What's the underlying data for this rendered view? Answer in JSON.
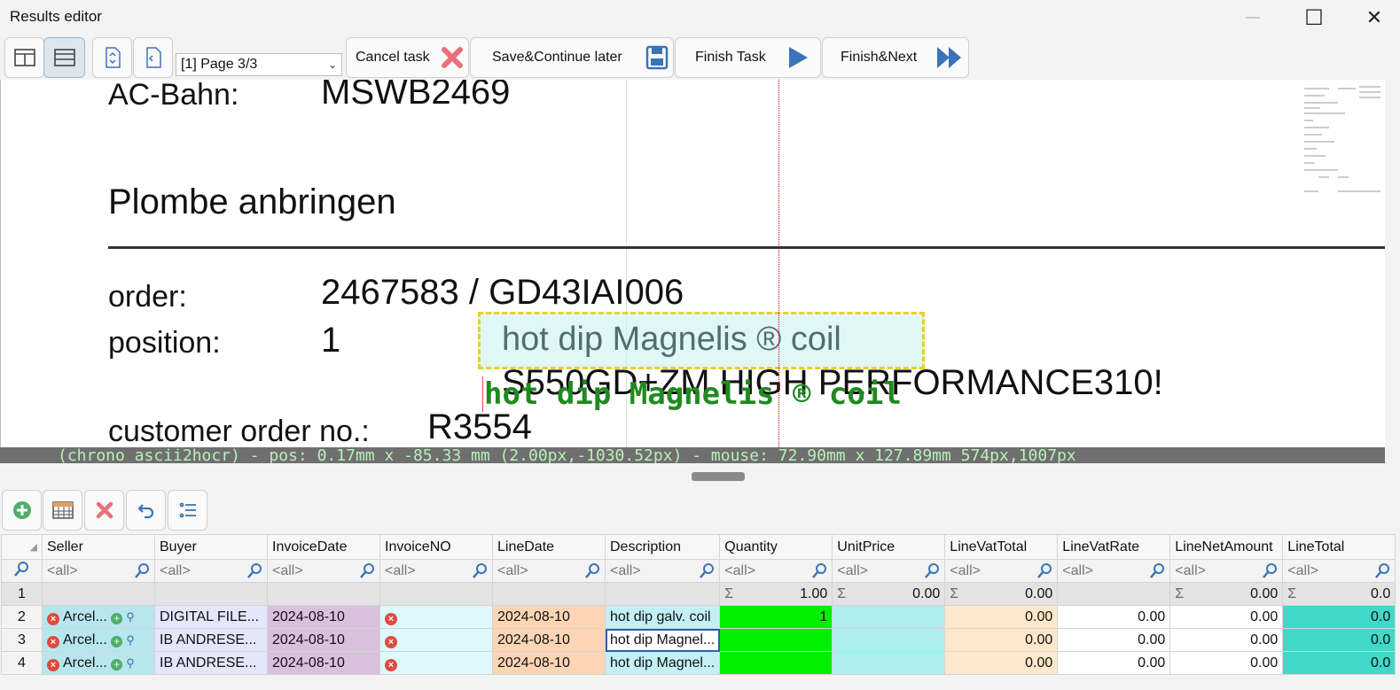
{
  "window": {
    "title": "Results editor",
    "minimize_glyph": "—",
    "maximize_glyph": "☐",
    "close_glyph": "✕"
  },
  "toolbar": {
    "page_select_value": "[1] Page 3/3",
    "cancel_label": "Cancel task",
    "save_label": "Save&Continue later",
    "finish_label": "Finish Task",
    "finish_next_label": "Finish&Next"
  },
  "document": {
    "line1_label": "AC-Bahn:",
    "line1_value": "MSWB2469",
    "heading": "Plombe anbringen",
    "order_label": "order:",
    "order_value": "2467583 / GD43IAI006",
    "position_label": "position:",
    "position_value": "1",
    "product_line": "S550GD+ZM HIGH PERFORMANCE310!",
    "customer_order_label": "customer order no.:",
    "customer_order_value": "R3554",
    "selection_text": "hot dip Magnelis ® coil",
    "ocr_overlay_text": "hot dip Magnelis ® coil"
  },
  "status": {
    "text": "(chrono ascii2hocr) - pos: 0.17mm x -85.33 mm (2.00px,-1030.52px) - mouse: 72.90mm x 127.89mm 574px,1007px"
  },
  "grid": {
    "filter_placeholder": "<all>",
    "columns": [
      "Seller",
      "Buyer",
      "InvoiceDate",
      "InvoiceNO",
      "LineDate",
      "Description",
      "Quantity",
      "UnitPrice",
      "LineVatTotal",
      "LineVatRate",
      "LineNetAmount",
      "LineTotal"
    ],
    "sum_row": {
      "row_no": "1",
      "sigma": "Σ",
      "quantity": "1.00",
      "unit_price": "0.00",
      "line_vat_total": "0.00",
      "line_net_amount": "0.00",
      "line_total": "0.0"
    },
    "rows": [
      {
        "row_no": "2",
        "seller": "Arcel...",
        "buyer": "DIGITAL FILE...",
        "invoice_date": "2024-08-10",
        "invoice_no": "",
        "line_date": "2024-08-10",
        "description": "hot dip galv. coil",
        "quantity": "1",
        "unit_price": "",
        "line_vat_total": "0.00",
        "line_vat_rate": "0.00",
        "line_net_amount": "0.00",
        "line_total": "0.0"
      },
      {
        "row_no": "3",
        "seller": "Arcel...",
        "buyer": "IB ANDRESE...",
        "invoice_date": "2024-08-10",
        "invoice_no": "",
        "line_date": "2024-08-10",
        "description": "hot dip Magnel...",
        "quantity": "",
        "unit_price": "",
        "line_vat_total": "0.00",
        "line_vat_rate": "0.00",
        "line_net_amount": "0.00",
        "line_total": "0.0"
      },
      {
        "row_no": "4",
        "seller": "Arcel...",
        "buyer": "IB ANDRESE...",
        "invoice_date": "2024-08-10",
        "invoice_no": "",
        "line_date": "2024-08-10",
        "description": "hot dip Magnel...",
        "quantity": "",
        "unit_price": "",
        "line_vat_total": "0.00",
        "line_vat_rate": "0.00",
        "line_net_amount": "0.00",
        "line_total": "0.0"
      }
    ]
  },
  "colors": {
    "accent_blue": "#3a74b6",
    "cancel_red": "#e8707a",
    "ocr_green": "#1f8a1f",
    "selection_yellow": "#e8cf2a",
    "quantity_green": "#00ee00",
    "line_total_teal": "#40d8c8"
  },
  "icons": {
    "layout_split_vertical": "layout-split-vertical-icon",
    "layout_split_horizontal": "layout-split-horizontal-icon",
    "fit_page": "fit-page-icon",
    "page_view": "page-view-icon",
    "cancel": "red-x-icon",
    "save": "floppy-disk-icon",
    "finish": "play-icon",
    "finish_next": "fast-forward-icon",
    "add_row": "add-circle-icon",
    "table_view": "table-icon",
    "delete_row": "red-x-icon",
    "undo": "undo-arrow-icon",
    "list_view": "list-icon",
    "filter": "magnifier-icon",
    "row_error": "error-circle-icon",
    "row_add": "plus-circle-icon",
    "row_lookup": "search-icon"
  }
}
